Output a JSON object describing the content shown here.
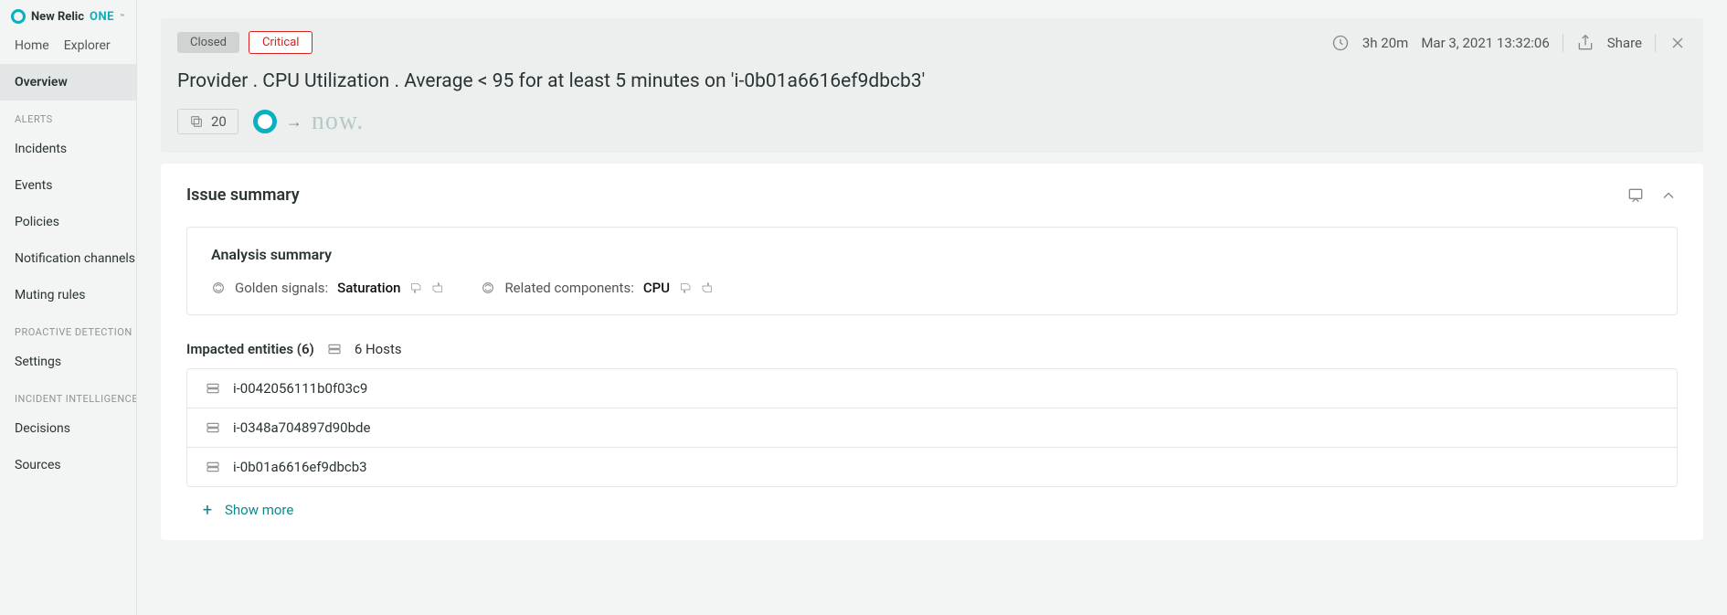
{
  "logo": {
    "brand": "New Relic",
    "suffix": "ONE",
    "tm": "™"
  },
  "topTabs": {
    "home": "Home",
    "explorer": "Explorer"
  },
  "sidebar": {
    "overview": "Overview",
    "alertsHeader": "ALERTS",
    "incidents": "Incidents",
    "events": "Events",
    "policies": "Policies",
    "notification": "Notification channels",
    "muting": "Muting rules",
    "proactiveHeader": "PROACTIVE DETECTION",
    "settings": "Settings",
    "incidentIntelHeader": "INCIDENT INTELLIGENCE",
    "decisions": "Decisions",
    "sources": "Sources"
  },
  "header": {
    "closed": "Closed",
    "critical": "Critical",
    "duration": "3h 20m",
    "timestamp": "Mar 3, 2021 13:32:06",
    "share": "Share",
    "title": "Provider . CPU Utilization . Average < 95 for at least 5 minutes on 'i-0b01a6616ef9dbcb3'",
    "count": "20",
    "nowText": "now."
  },
  "summary": {
    "sectionTitle": "Issue summary",
    "analysisTitle": "Analysis summary",
    "goldenLabel": "Golden signals:",
    "goldenValue": "Saturation",
    "relatedLabel": "Related components:",
    "relatedValue": "CPU",
    "impactedTitle": "Impacted entities (6)",
    "hostsCount": "6 Hosts",
    "entities": [
      "i-0042056111b0f03c9",
      "i-0348a704897d90bde",
      "i-0b01a6616ef9dbcb3"
    ],
    "showMore": "Show more"
  }
}
